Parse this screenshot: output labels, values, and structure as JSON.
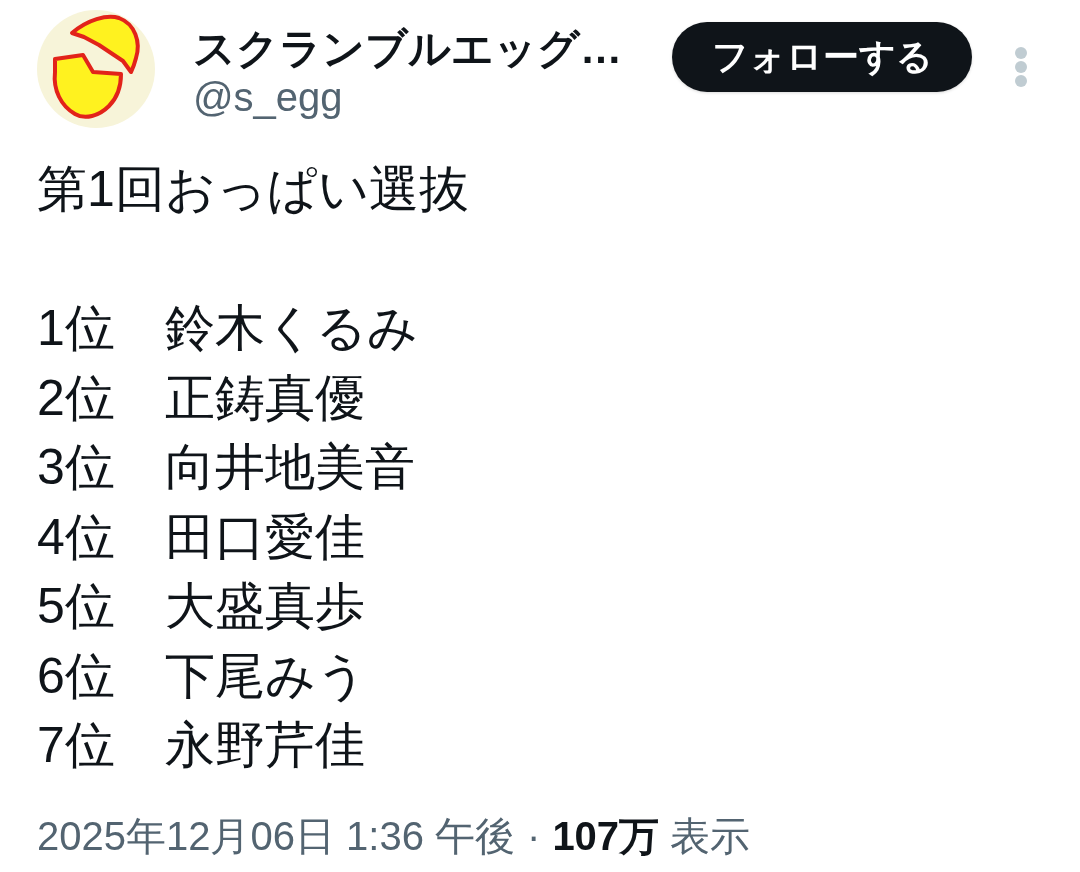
{
  "author": {
    "name": "スクランブルエッグ…",
    "handle": "@s_egg"
  },
  "follow_button": {
    "label": "フォローする"
  },
  "tweet": {
    "text": "第1回おっぱい選抜\n\n1位　鈴木くるみ\n2位　正鋳真優\n3位　向井地美音\n4位　田口愛佳\n5位　大盛真歩\n6位　下尾みう\n7位　永野芹佳"
  },
  "meta": {
    "timestamp": "2025年12月06日 1:36 午後",
    "separator": "·",
    "views": "**107万** 表示"
  }
}
